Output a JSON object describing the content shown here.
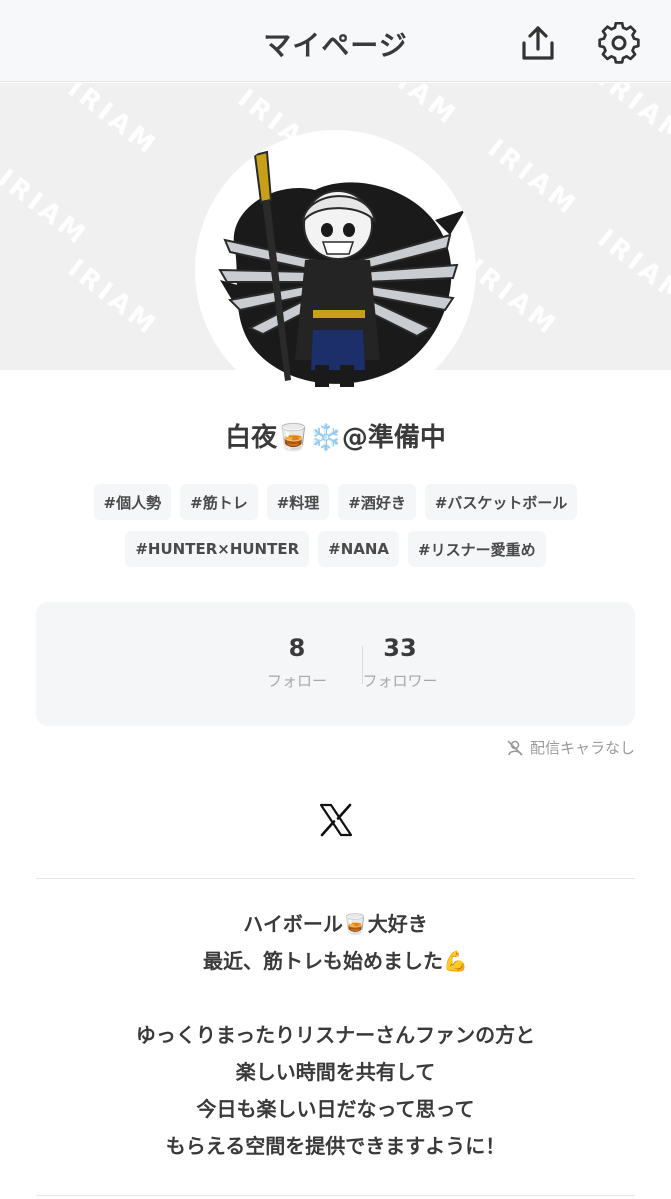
{
  "header": {
    "title": "マイページ",
    "share_icon": "share-upload-icon",
    "settings_icon": "gear-icon"
  },
  "cover": {
    "watermark_text": "IRIAM",
    "background": "#f0f0f0"
  },
  "profile": {
    "name": "白夜🥃❄️@準備中",
    "tags_row1": [
      "#個人勢",
      "#筋トレ",
      "#料理",
      "#酒好き",
      "#バスケットボール"
    ],
    "tags_row2": [
      "#HUNTER×HUNTER",
      "#NANA",
      "#リスナー愛重め"
    ]
  },
  "stats": {
    "follow_count": "8",
    "follow_label": "フォロー",
    "follower_count": "33",
    "follower_label": "フォロワー"
  },
  "character": {
    "status": "配信キャラなし",
    "icon": "no-character-icon"
  },
  "social": {
    "x_icon": "x-logo-icon"
  },
  "bio": {
    "lines": [
      "ハイボール🥃大好き",
      "最近、筋トレも始めました💪",
      "",
      "ゆっくりまったりリスナーさんファンの方と",
      "楽しい時間を共有して",
      "今日も楽しい日だなって思って",
      "もらえる空間を提供できますように！"
    ]
  },
  "colors": {
    "header_bg": "#f6f8f9",
    "tag_bg": "#f4f6f8",
    "text": "#3a3a3a",
    "muted": "#a8a8a8"
  }
}
